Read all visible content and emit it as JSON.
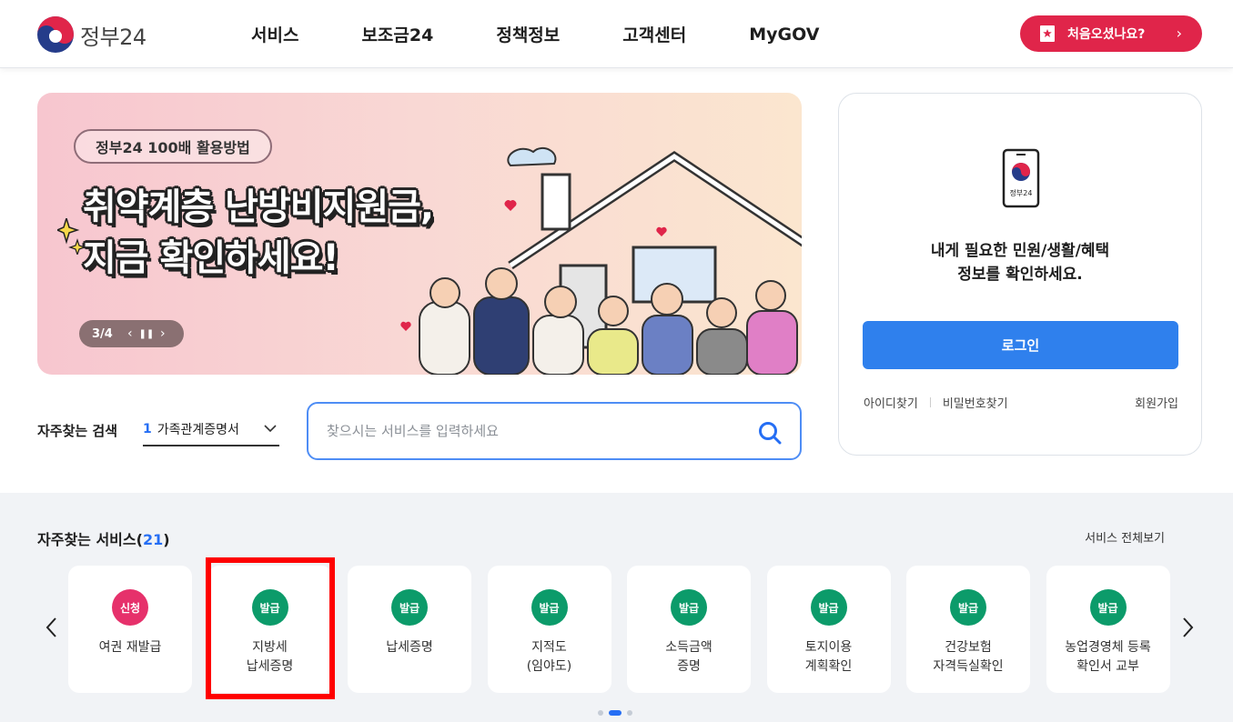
{
  "header": {
    "logo_text": "정부24",
    "nav": [
      "서비스",
      "보조금24",
      "정책정보",
      "고객센터",
      "MyGOV"
    ],
    "cta_label": "처음오셨나요?"
  },
  "banner": {
    "tag": "정부24 100배 활용방법",
    "title": "취약계층 난방비지원금,\n지금 확인하세요!",
    "pager_count": "3/4"
  },
  "search": {
    "label": "자주찾는 검색",
    "selected_num": "1",
    "selected_text": "가족관계증명서",
    "placeholder": "찾으시는 서비스를 입력하세요"
  },
  "login": {
    "icon_caption": "정부24",
    "message": "내게 필요한 민원/생활/혜택\n정보를 확인하세요.",
    "button": "로그인",
    "find_id": "아이디찾기",
    "find_pw": "비밀번호찾기",
    "join": "회원가입"
  },
  "services": {
    "title": "자주찾는 서비스(",
    "count": "21",
    "title_end": ")",
    "view_all": "서비스 전체보기",
    "items": [
      {
        "badge": "신청",
        "badge_color": "#e6316b",
        "label": "여권 재발급"
      },
      {
        "badge": "발급",
        "badge_color": "#0c9b6a",
        "label": "지방세\n납세증명"
      },
      {
        "badge": "발급",
        "badge_color": "#0c9b6a",
        "label": "납세증명"
      },
      {
        "badge": "발급",
        "badge_color": "#0c9b6a",
        "label": "지적도\n(임야도)"
      },
      {
        "badge": "발급",
        "badge_color": "#0c9b6a",
        "label": "소득금액\n증명"
      },
      {
        "badge": "발급",
        "badge_color": "#0c9b6a",
        "label": "토지이용\n계획확인"
      },
      {
        "badge": "발급",
        "badge_color": "#0c9b6a",
        "label": "건강보험\n자격득실확인"
      },
      {
        "badge": "발급",
        "badge_color": "#0c9b6a",
        "label": "농업경영체 등록\n확인서 교부"
      }
    ],
    "page_count": 3,
    "active_page": 2
  },
  "colors": {
    "primary": "#256ef4",
    "cta": "#e0254a",
    "login_button": "#2f80ed",
    "highlight": "#ff0000"
  }
}
